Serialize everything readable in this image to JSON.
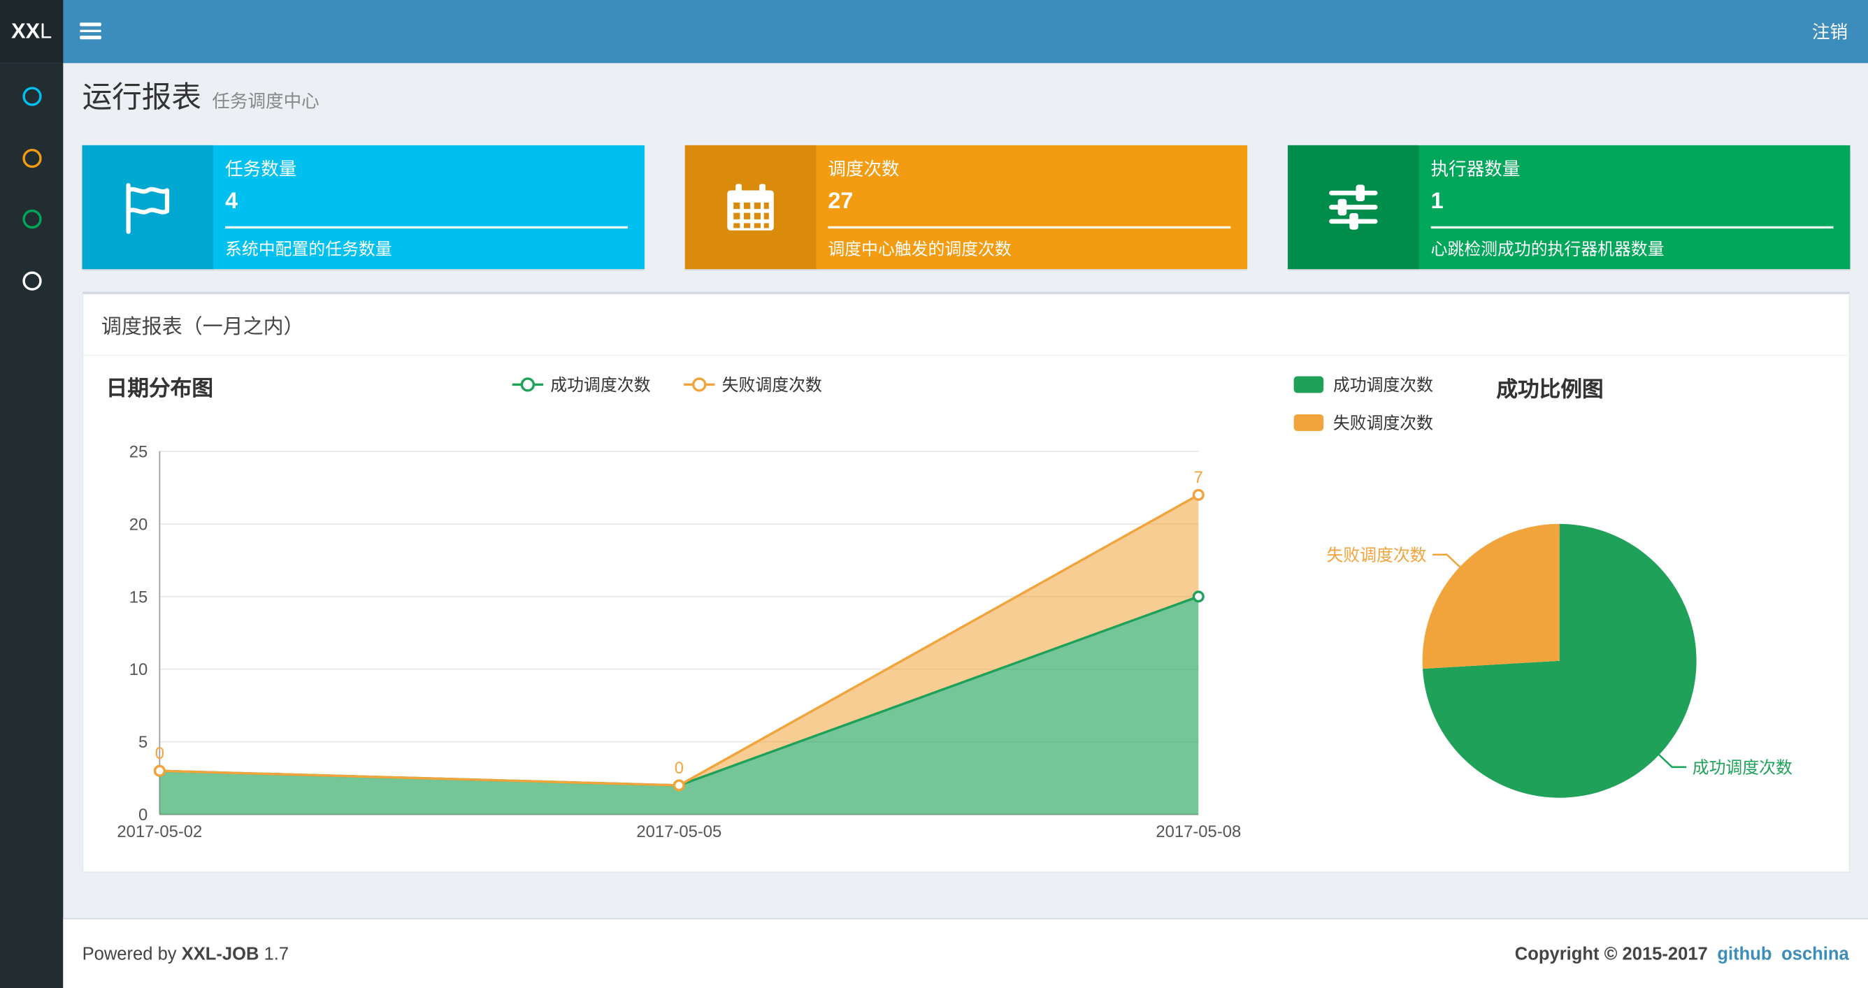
{
  "navbar": {
    "logo_bold": "XX",
    "logo_regular": "L",
    "logout_label": "注销"
  },
  "sidebar": {
    "items": [
      {
        "name": "menu-1",
        "color": "#00c0ef"
      },
      {
        "name": "menu-2",
        "color": "#f39c12"
      },
      {
        "name": "menu-3",
        "color": "#00a65a"
      },
      {
        "name": "menu-4",
        "color": "#ffffff"
      }
    ]
  },
  "page_header": {
    "title": "运行报表",
    "subtitle": "任务调度中心"
  },
  "info_boxes": [
    {
      "title": "任务数量",
      "value": "4",
      "description": "系统中配置的任务数量",
      "bg_color": "#00c0ef",
      "icon_bg_color": "#00a7d0",
      "icon": "flag-icon"
    },
    {
      "title": "调度次数",
      "value": "27",
      "description": "调度中心触发的调度次数",
      "bg_color": "#f39c12",
      "icon_bg_color": "#db8b0b",
      "icon": "calendar-icon"
    },
    {
      "title": "执行器数量",
      "value": "1",
      "description": "心跳检测成功的执行器机器数量",
      "bg_color": "#00a65a",
      "icon_bg_color": "#008d4c",
      "icon": "sliders-icon"
    }
  ],
  "panel": {
    "title": "调度报表（一月之内）"
  },
  "chart_data": [
    {
      "type": "area",
      "title": "日期分布图",
      "x": [
        "2017-05-02",
        "2017-05-05",
        "2017-05-08"
      ],
      "series": [
        {
          "name": "成功调度次数",
          "values": [
            3,
            2,
            15
          ],
          "color": "#1fa159"
        },
        {
          "name": "失败调度次数",
          "values": [
            0,
            0,
            7
          ],
          "color": "#f2a43c"
        }
      ],
      "stacked": true,
      "point_labels_series": "失败调度次数",
      "point_labels": [
        "0",
        "0",
        "7"
      ],
      "ylim": [
        0,
        25
      ],
      "y_ticks": [
        0,
        5,
        10,
        15,
        20,
        25
      ],
      "grid": true,
      "legend_position": "top"
    },
    {
      "type": "pie",
      "title": "成功比例图",
      "slices": [
        {
          "name": "成功调度次数",
          "value": 20,
          "color": "#1fa159"
        },
        {
          "name": "失败调度次数",
          "value": 7,
          "color": "#f2a43c"
        }
      ],
      "legend_position": "top-left"
    }
  ],
  "footer": {
    "powered_by_prefix": "Powered by",
    "product": "XXL-JOB",
    "version": "1.7",
    "copyright": "Copyright © 2015-2017",
    "links": [
      "github",
      "oschina"
    ]
  }
}
